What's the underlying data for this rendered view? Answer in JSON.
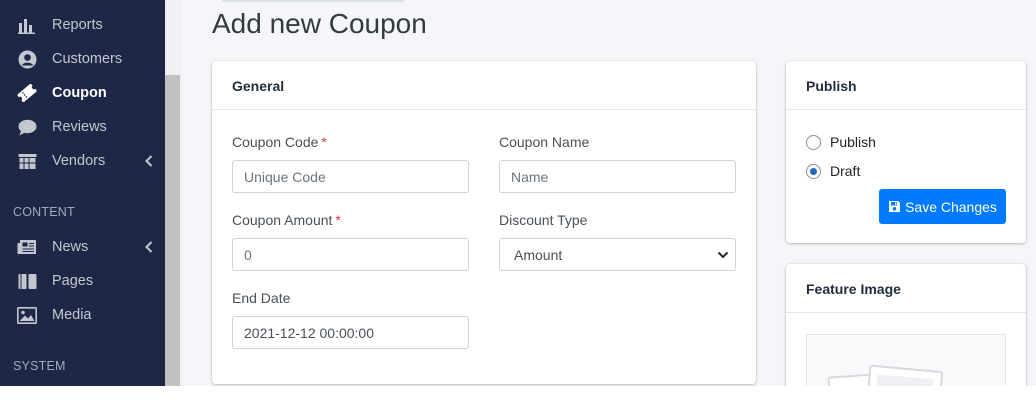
{
  "sidebar": {
    "items": [
      {
        "label": "Reports",
        "icon": "bar-chart-icon"
      },
      {
        "label": "Customers",
        "icon": "user-circle-icon"
      },
      {
        "label": "Coupon",
        "icon": "ticket-icon",
        "active": true
      },
      {
        "label": "Reviews",
        "icon": "comment-icon"
      },
      {
        "label": "Vendors",
        "icon": "store-icon"
      }
    ],
    "sections": {
      "content": {
        "header": "CONTENT",
        "items": [
          {
            "label": "News",
            "icon": "newspaper-icon"
          },
          {
            "label": "Pages",
            "icon": "book-icon"
          },
          {
            "label": "Media",
            "icon": "image-icon"
          }
        ]
      },
      "system": {
        "header": "SYSTEM"
      }
    }
  },
  "page": {
    "title": "Add new Coupon"
  },
  "general": {
    "title": "General",
    "coupon_code": {
      "label": "Coupon Code",
      "required_mark": "*",
      "placeholder": "Unique Code"
    },
    "coupon_name": {
      "label": "Coupon Name",
      "placeholder": "Name"
    },
    "coupon_amount": {
      "label": "Coupon Amount",
      "required_mark": "*",
      "placeholder": "0"
    },
    "discount_type": {
      "label": "Discount Type",
      "value": "Amount"
    },
    "end_date": {
      "label": "End Date",
      "value": "2021-12-12 00:00:00"
    }
  },
  "publish": {
    "title": "Publish",
    "options": [
      {
        "label": "Publish",
        "checked": false
      },
      {
        "label": "Draft",
        "checked": true
      }
    ],
    "save_label": "Save Changes"
  },
  "feature_image": {
    "title": "Feature Image"
  },
  "colors": {
    "sidebar_bg": "#1e2746",
    "primary": "#007bff",
    "required": "#dc3545",
    "content_bg": "#f4f6f9"
  }
}
